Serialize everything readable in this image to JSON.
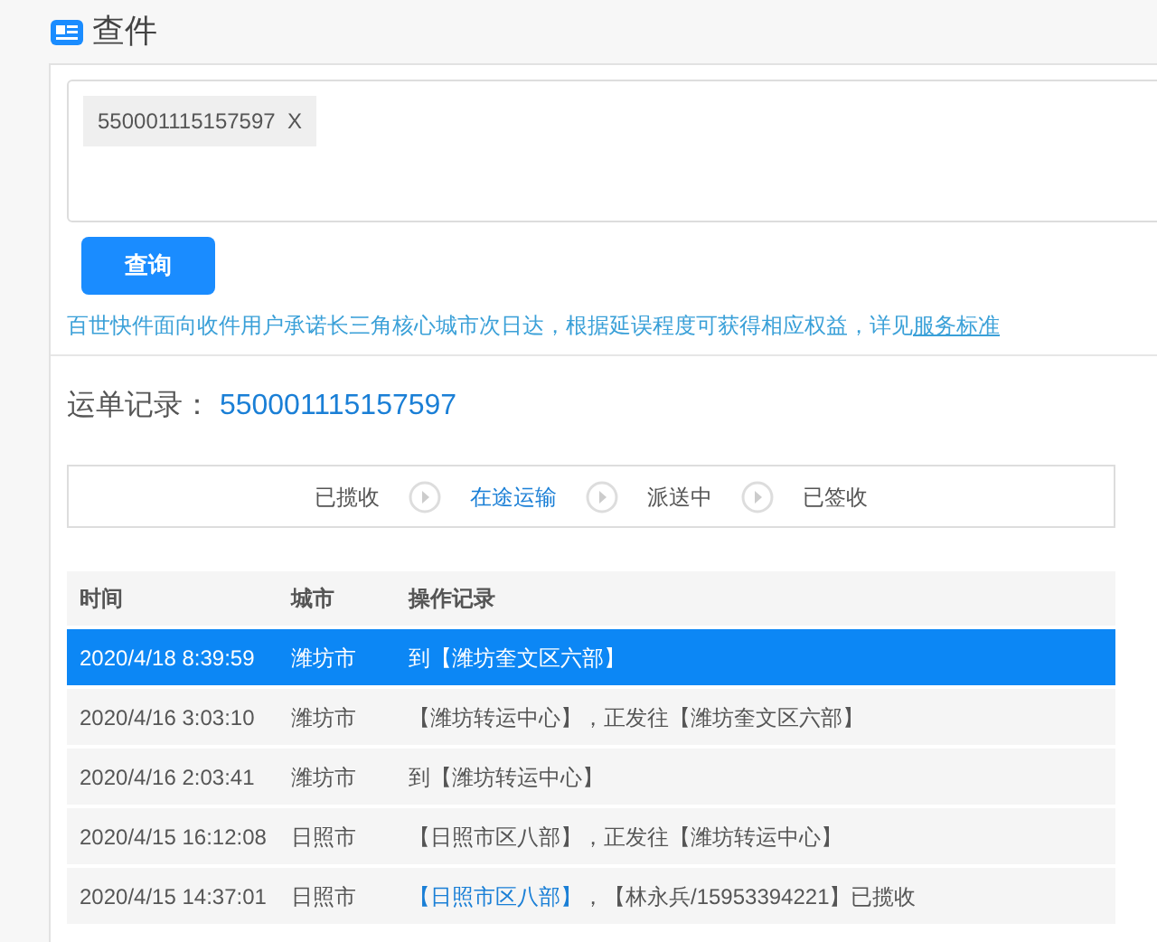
{
  "header": {
    "title": "查件"
  },
  "query": {
    "tags": [
      {
        "number": "550001115157597",
        "remove": "X"
      }
    ],
    "button": "查询",
    "note": "百世快件面向收件用户承诺长三角核心城市次日达，根据延误程度可获得相应权益，详见",
    "note_link": "服务标准"
  },
  "waybill": {
    "label": "运单记录：",
    "number": "550001115157597"
  },
  "steps": [
    {
      "label": "已揽收",
      "selected": false
    },
    {
      "label": "在途运输",
      "selected": true
    },
    {
      "label": "派送中",
      "selected": false
    },
    {
      "label": "已签收",
      "selected": false
    }
  ],
  "table": {
    "columns": [
      "时间",
      "城市",
      "操作记录"
    ],
    "rows": [
      {
        "time": "2020/4/18 8:39:59",
        "city": "潍坊市",
        "record": "到【潍坊奎文区六部】",
        "selected": true
      },
      {
        "time": "2020/4/16 3:03:10",
        "city": "潍坊市",
        "record": "【潍坊转运中心】，正发往【潍坊奎文区六部】",
        "selected": false
      },
      {
        "time": "2020/4/16 2:03:41",
        "city": "潍坊市",
        "record": "到【潍坊转运中心】",
        "selected": false
      },
      {
        "time": "2020/4/15 16:12:08",
        "city": "日照市",
        "record": "【日照市区八部】，正发往【潍坊转运中心】",
        "selected": false
      },
      {
        "time": "2020/4/15 14:37:01",
        "city": "日照市",
        "record_link": "【日照市区八部】",
        "record": "，【林永兵/15953394221】已揽收",
        "selected": false
      }
    ]
  }
}
